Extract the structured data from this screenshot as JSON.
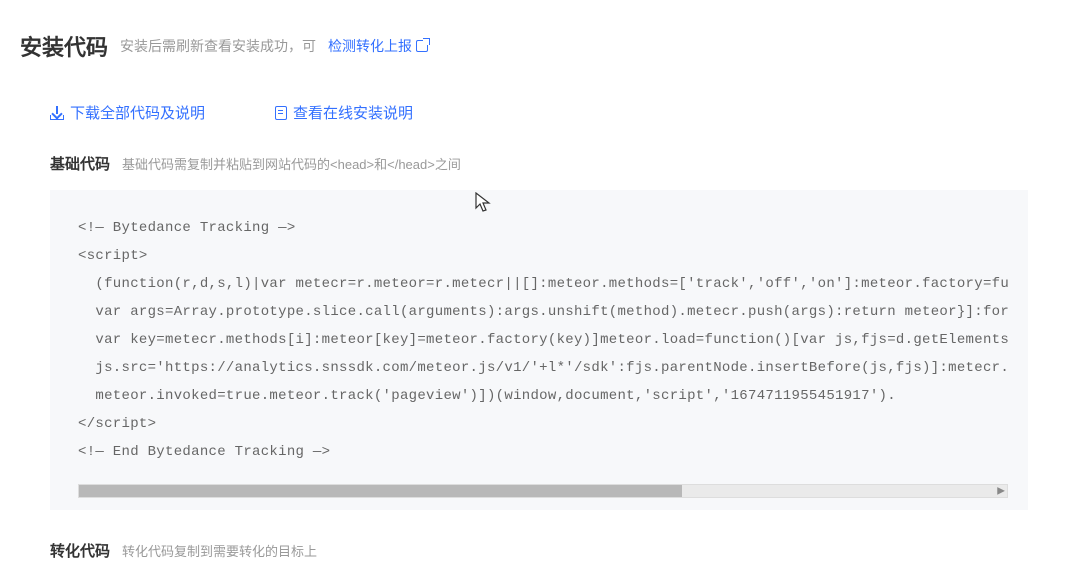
{
  "header": {
    "title": "安装代码",
    "subtitle": "安装后需刷新查看安装成功，可",
    "verify_label": "检测转化上报"
  },
  "actions": {
    "download_label": "下载全部代码及说明",
    "view_doc_label": "查看在线安装说明"
  },
  "section_base": {
    "title": "基础代码",
    "desc": "基础代码需复制并粘贴到网站代码的<head>和</head>之间"
  },
  "code": {
    "line1": "<!— Bytedance Tracking —>",
    "line2": "<script>",
    "line3": "  (function(r,d,s,l)|var metecr=r.meteor=r.metecr||[]:meteor.methods=['track','off','on']:meteor.factory=func",
    "line4": "  var args=Array.prototype.slice.call(arguments):args.unshift(method).metecr.push(args):return meteor}]:for(v",
    "line5": "  var key=metecr.methods[i]:meteor[key]=meteor.factory(key)]meteor.load=function()[var js,fjs=d.getElementsBy",
    "line6": "  js.src='https://analytics.snssdk.com/meteor.js/v1/'+l*'/sdk':fjs.parentNode.insertBefore(js,fjs)]:metecr.lo",
    "line7": "  meteor.invoked=true.meteor.track('pageview')])(window,document,'script','1674711955451917').",
    "line8": "</script>",
    "line9": "<!— End Bytedance Tracking —>"
  },
  "section_convert": {
    "title": "转化代码",
    "desc": "转化代码复制到需要转化的目标上"
  }
}
